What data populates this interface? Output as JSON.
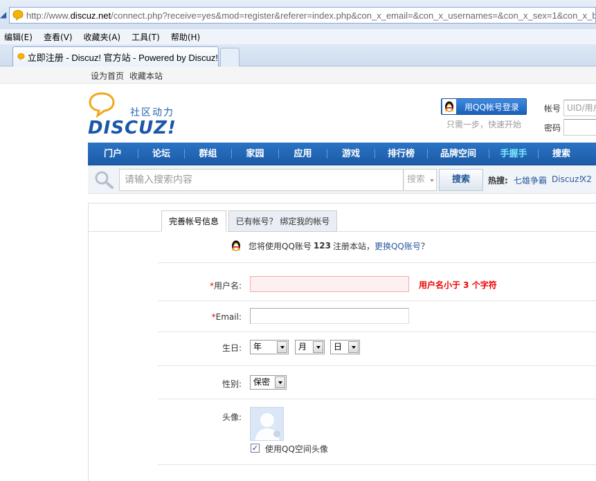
{
  "browser": {
    "url_scheme": "http://www.",
    "url_domain": "discuz.net",
    "url_rest": "/connect.php?receive=yes&mod=register&referer=index.php&con_x_email=&con_x_usernames=&con_x_sex=1&con_x_b",
    "menu": [
      "编辑(E)",
      "查看(V)",
      "收藏夹(A)",
      "工具(T)",
      "帮助(H)"
    ],
    "tab_title": "立即注册 - Discuz! 官方站 - Powered by Discuz!"
  },
  "topbar": {
    "set_home": "设为首页",
    "bookmark": "收藏本站"
  },
  "logo": {
    "cn": "社区动力",
    "en": "DISCUZ!"
  },
  "login": {
    "qq_button": "用QQ帐号登录",
    "qq_tip": "只需一步，快速开始",
    "account_label": "帐号",
    "account_placeholder": "UID/用户",
    "password_label": "密码"
  },
  "nav": [
    "门户",
    "论坛",
    "群组",
    "家园",
    "应用",
    "游戏",
    "排行榜",
    "品牌空间",
    "手握手",
    "搜索"
  ],
  "search": {
    "placeholder": "请输入搜索内容",
    "type": "搜索",
    "button": "搜索",
    "hot_label": "热搜:",
    "hot": [
      "七雄争霸",
      "Discuz!",
      "X2"
    ]
  },
  "form": {
    "tab_active": "完善帐号信息",
    "tab_inactive": "已有帐号？ 绑定我的帐号",
    "notice_prefix": "您将使用QQ账号",
    "notice_account": "123",
    "notice_mid": "注册本站，",
    "notice_link": "更换QQ账号",
    "notice_suffix": "？",
    "username_label": "用户名:",
    "username_error": "用户名小于 3 个字符",
    "email_label": "Email:",
    "birthday_label": "生日:",
    "year": "年",
    "month": "月",
    "day": "日",
    "gender_label": "性别:",
    "gender_value": "保密",
    "avatar_label": "头像:",
    "use_qq_avatar": "使用QQ空间头像",
    "use_qq_avatar_checked": true,
    "required_mark": "*"
  }
}
